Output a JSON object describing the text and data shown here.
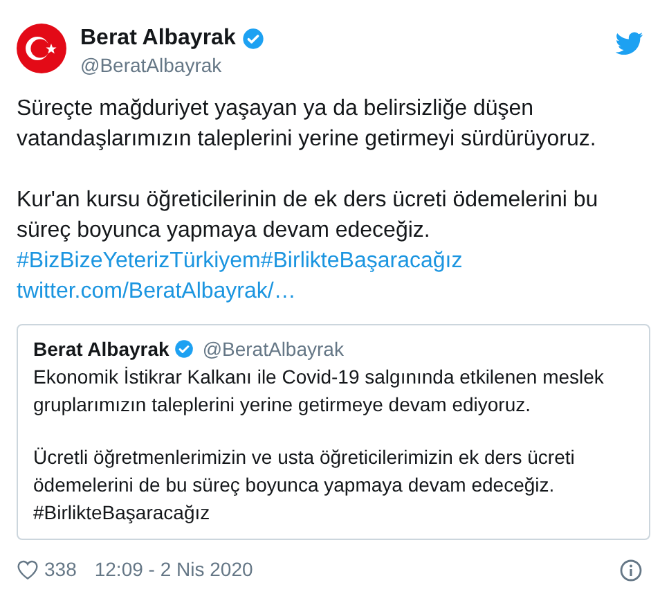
{
  "author": {
    "name": "Berat Albayrak",
    "handle": "@BeratAlbayrak",
    "verified": true
  },
  "paragraphs": [
    "Süreçte mağduriyet yaşayan ya da belirsizliğe düşen vatandaşlarımızın taleplerini yerine getirmeyi sürdürüyoruz.",
    "Kur'an kursu öğreticilerinin de ek ders ücreti ödemelerini bu süreç boyunca yapmaya devam edeceğiz."
  ],
  "hashtags": [
    "#BizBizeYeterizTürkiyem",
    "#BirlikteBaşaracağız"
  ],
  "link": "twitter.com/BeratAlbayrak/…",
  "quoted": {
    "name": "Berat Albayrak",
    "handle": "@BeratAlbayrak",
    "verified": true,
    "paragraphs": [
      "Ekonomik İstikrar Kalkanı ile Covid-19 salgınında etkilenen meslek gruplarımızın taleplerini yerine getirmeye devam ediyoruz.",
      "Ücretli öğretmenlerimizin ve usta öğreticilerimizin ek ders ücreti ödemelerini de bu süreç boyunca yapmaya devam edeceğiz."
    ],
    "hashtags": [
      "#BirlikteBaşaracağız"
    ]
  },
  "footer": {
    "likes": "338",
    "timestamp": "12:09 - 2 Nis 2020"
  }
}
